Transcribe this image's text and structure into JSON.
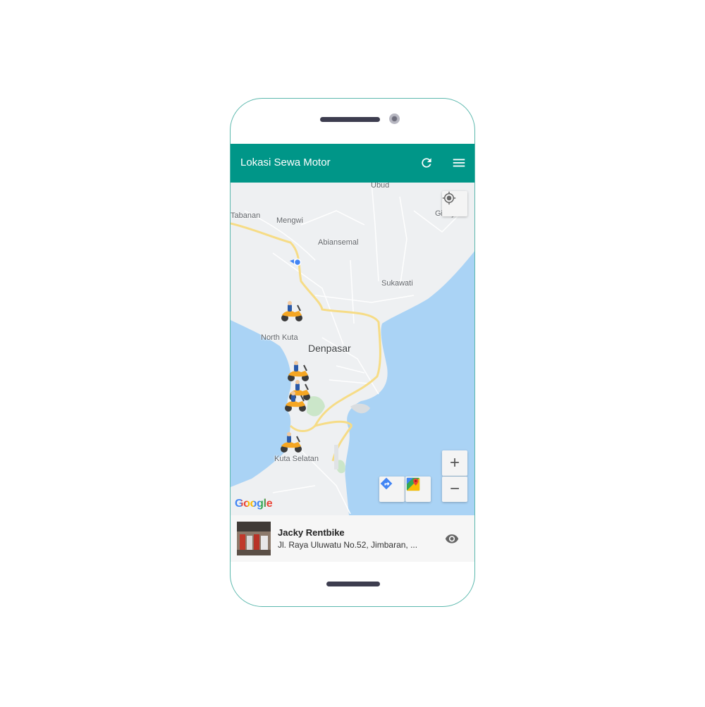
{
  "app": {
    "title": "Lokasi Sewa Motor",
    "refresh_icon": "refresh-icon",
    "menu_icon": "menu-icon",
    "colors": {
      "appbar": "#009688",
      "water": "#aad3f5",
      "land": "#eef0f2",
      "road": "#f6dc86",
      "marker": "#f5a623"
    }
  },
  "map": {
    "places": {
      "ubud": "Ubud",
      "tabanan": "Tabanan",
      "mengwi": "Mengwi",
      "gianyar": "Gianyar",
      "abiansemal": "Abiansemal",
      "sukawati": "Sukawati",
      "north_kuta": "North Kuta",
      "denpasar": "Denpasar",
      "kuta_selatan": "Kuta Selatan"
    },
    "attribution": "Google",
    "markers_count": 5,
    "controls": {
      "my_location_icon": "my-location-icon",
      "zoom_in": "+",
      "zoom_out": "−",
      "directions_icon": "directions-icon",
      "google_maps_icon": "google-maps-icon"
    }
  },
  "selected": {
    "name": "Jacky Rentbike",
    "address": "Jl. Raya Uluwatu No.52, Jimbaran, ...",
    "view_icon": "eye-icon"
  }
}
